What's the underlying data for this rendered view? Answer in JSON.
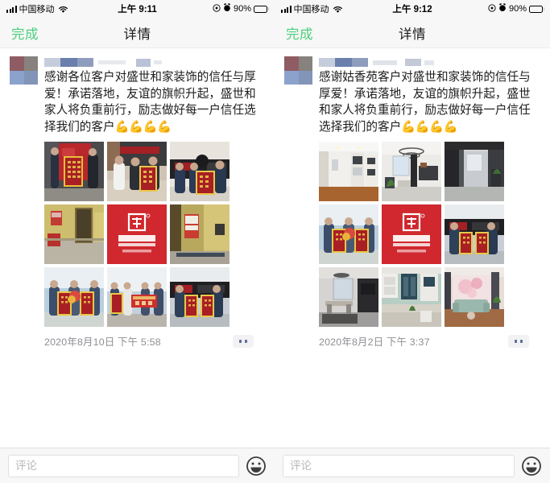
{
  "meta": {
    "app": "WeChat Moments Detail",
    "accent_green": "#4cd07d",
    "navbar_bg": "#f7f7f7",
    "timestamp_color": "#8e8e93"
  },
  "panels": [
    {
      "id": "left",
      "status_bar": {
        "carrier": "中国移动",
        "time": "上午 9:11",
        "battery_percent": "90%",
        "signal_bars": 4,
        "icons": [
          "signal-icon",
          "wifi-icon",
          "location-icon",
          "alarm-icon",
          "battery-icon"
        ]
      },
      "nav": {
        "done_label": "完成",
        "title": "详情"
      },
      "post": {
        "avatar_colors": [
          "#8f5c64",
          "#87827e",
          "#8ba2cc",
          "#8294b8"
        ],
        "username_masked": true,
        "username_blocks": [
          "#c2cadc",
          "#6b7fae",
          "#8e9cbd",
          "#dfe2ea",
          "#b9c2d6"
        ],
        "text": "感谢各位客户对盛世和家装饰的信任与厚爱！承诺落地，友谊的旗帜升起，盛世和家人将负重前行，励志做好每一户信任选择我们的客户",
        "emoji": "💪💪💪💪",
        "images": [
          {
            "alt": "两人在红色背景墙前展示锦旗",
            "kind": "banner-photo"
          },
          {
            "alt": "三人在店内持锦旗合影",
            "kind": "banner-photo"
          },
          {
            "alt": "店内员工与客户持锦旗合影",
            "kind": "banner-photo"
          },
          {
            "alt": "黄色墙面毛坯房室内",
            "kind": "room-photo"
          },
          {
            "alt": "盛世和家装饰红色品牌标识 HP.SSHJ.COM",
            "kind": "logo"
          },
          {
            "alt": "黄色墙面走廊与门洞",
            "kind": "room-photo"
          },
          {
            "alt": "三人持锦旗与鲜花合影",
            "kind": "banner-photo"
          },
          {
            "alt": "四人持红色横幅合影",
            "kind": "banner-photo"
          },
          {
            "alt": "两人持双锦旗合影",
            "kind": "banner-photo"
          }
        ],
        "timestamp": "2020年8月10日 下午 5:58",
        "more_label": "••"
      },
      "comment": {
        "placeholder": "评论",
        "value": "",
        "emoji_button": "smiley-icon"
      }
    },
    {
      "id": "right",
      "status_bar": {
        "carrier": "中国移动",
        "time": "上午 9:12",
        "battery_percent": "90%",
        "signal_bars": 4,
        "icons": [
          "signal-icon",
          "wifi-icon",
          "location-icon",
          "alarm-icon",
          "battery-icon"
        ]
      },
      "nav": {
        "done_label": "完成",
        "title": "详情"
      },
      "post": {
        "avatar_colors": [
          "#8f5c64",
          "#87827e",
          "#8ba2cc",
          "#8294b8"
        ],
        "username_masked": true,
        "username_blocks": [
          "#c2cadc",
          "#6b7fae",
          "#8e9cbd",
          "#dfe2ea",
          "#b9c2d6"
        ],
        "text": "感谢姑香苑客户对盛世和家装饰的信任与厚爱！承诺落地，友谊的旗帜升起，盛世和家人将负重前行，励志做好每一户信任选择我们的客户",
        "emoji": "💪💪💪💪",
        "images": [
          {
            "alt": "白色定制柜体客厅",
            "kind": "room-photo"
          },
          {
            "alt": "现代客厅吊灯与沙发",
            "kind": "room-photo"
          },
          {
            "alt": "玻璃隔断过道",
            "kind": "room-photo"
          },
          {
            "alt": "三人持锦旗与鲜花合影",
            "kind": "banner-photo"
          },
          {
            "alt": "盛世和家装饰红色品牌标识 HP.SSHJ.COM",
            "kind": "logo"
          },
          {
            "alt": "两人持双锦旗店内合影",
            "kind": "banner-photo"
          },
          {
            "alt": "餐厅吊灯与餐桌",
            "kind": "room-photo"
          },
          {
            "alt": "绿色厨房橱柜",
            "kind": "room-photo"
          },
          {
            "alt": "粉色花卉背景墙客厅沙发",
            "kind": "room-photo"
          }
        ],
        "timestamp": "2020年8月2日 下午 3:37",
        "more_label": "••"
      },
      "comment": {
        "placeholder": "评论",
        "value": "",
        "emoji_button": "smiley-icon"
      }
    }
  ]
}
